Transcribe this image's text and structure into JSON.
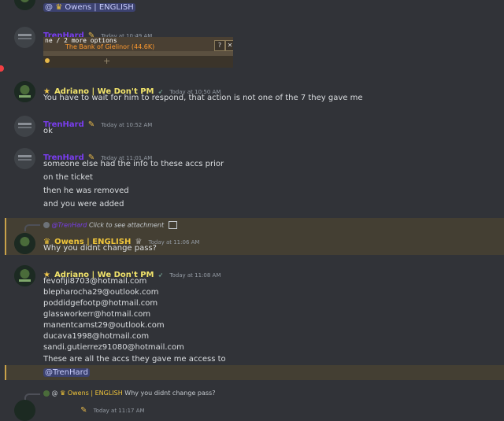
{
  "messages": {
    "m0": {
      "mention_user": "@",
      "mention_name": "Owens | ENGLISH"
    },
    "m1": {
      "username": "TrenHard",
      "timestamp": "Today at 10:49 AM",
      "embed": {
        "line1": "ne / 2 more options",
        "line2": "The Bank of Gielinor (44.6K)",
        "q": "?"
      }
    },
    "m2": {
      "username": "Adriano | We Don't PM",
      "timestamp": "Today at 10:50 AM",
      "text": "You have to wait for him to respond, that action is not one of the 7 they gave me"
    },
    "m3": {
      "username": "TrenHard",
      "timestamp": "Today at 10:52 AM",
      "text": "ok"
    },
    "m4": {
      "username": "TrenHard",
      "timestamp": "Today at 11:01 AM",
      "lines": [
        "someone else had the info to these accs prior",
        "on the ticket",
        "then he was removed",
        "and you were added"
      ]
    },
    "m5": {
      "reply_author": "@TrenHard",
      "reply_text": "Click to see attachment",
      "username": "Owens | ENGLISH",
      "timestamp": "Today at 11:06 AM",
      "text": "Why you didnt change pass?"
    },
    "m6": {
      "username": "Adriano | We Don't PM",
      "timestamp": "Today at 11:08 AM",
      "emails": [
        "fevofiji8703@hotmail.com",
        "blepharocha29@outlook.com",
        "poddidgefootp@hotmail.com",
        "glassworkerr@hotmail.com",
        "manentcamst29@outlook.com",
        "ducava1998@hotmail.com",
        "sandi.gutierrez91080@hotmail.com"
      ],
      "text": "These are all the accs they gave me access to",
      "mention": "@TrenHard"
    },
    "m7": {
      "reply_at": "@",
      "reply_author": "Owens | ENGLISH",
      "reply_text": "Why you didnt change pass?",
      "timestamp_partial": "Today at 11:17 AM"
    }
  },
  "colors": {
    "background": "#313338",
    "trenhard": "#7a3df0",
    "adriano": "#f2e46b",
    "owens": "#f0c53a",
    "highlight": "#443f33",
    "mention_bg": "#3c4270"
  }
}
